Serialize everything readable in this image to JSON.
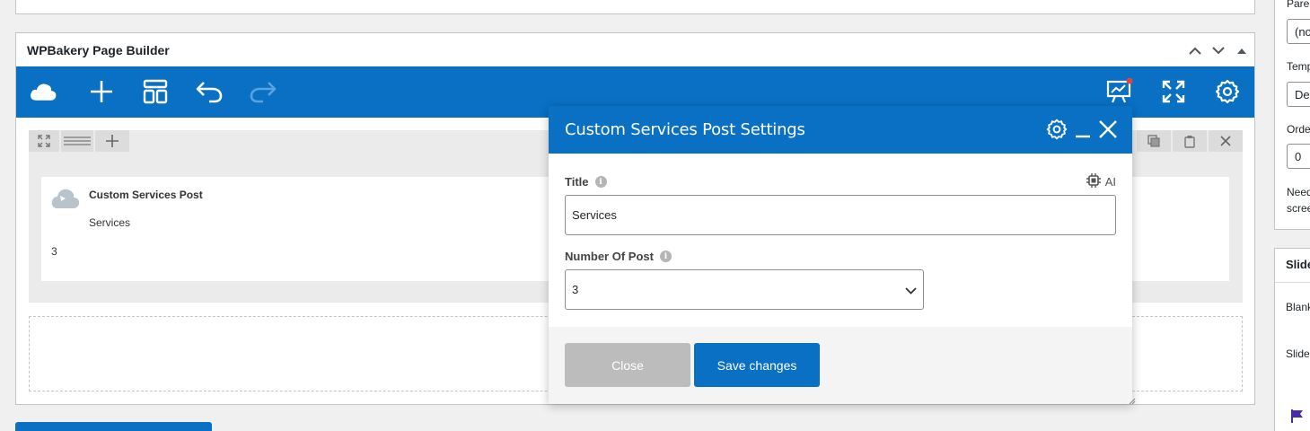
{
  "builder": {
    "title": "WPBakery Page Builder"
  },
  "element": {
    "title": "Custom Services Post",
    "subtitle": "Services",
    "number": "3"
  },
  "modal": {
    "title": "Custom Services Post Settings",
    "ai_label": "AI",
    "fields": {
      "title_label": "Title",
      "title_value": "Services",
      "count_label": "Number Of Post",
      "count_value": "3"
    },
    "close_label": "Close",
    "save_label": "Save changes"
  },
  "sidebar": {
    "parent_label": "Parent",
    "parent_value": "(no parent)",
    "template_label": "Template",
    "template_value": "Default template",
    "order_label": "Order",
    "order_value": "0",
    "help_line1": "Need help?",
    "help_line2": "screen",
    "slider_heading": "Slider",
    "blank_label": "Blank",
    "slider_label": "Slider"
  },
  "colors": {
    "accent": "#0a70c4",
    "notification": "#e24343",
    "flag": "#4a2aa6"
  },
  "icons": [
    "cloud-icon",
    "plus-icon",
    "layout-icon",
    "undo-icon",
    "redo-icon",
    "chart-icon",
    "fullscreen-icon",
    "gear-icon",
    "close-icon",
    "minimize-icon",
    "chip-icon",
    "info-icon",
    "chevron-down-icon",
    "flag-icon"
  ]
}
